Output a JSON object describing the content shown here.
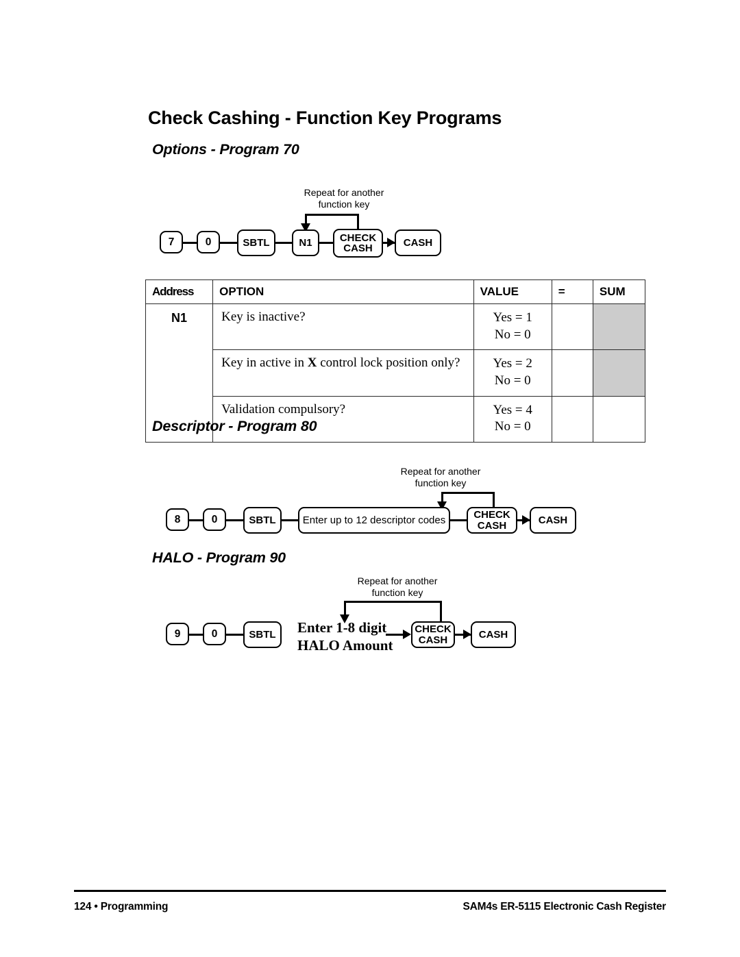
{
  "page": {
    "title": "Check Cashing - Function Key Programs"
  },
  "sections": {
    "options": {
      "heading": "Options - Program 70",
      "diagram": {
        "loop_label": "Repeat for another\nfunction key",
        "keys": [
          {
            "label": "7"
          },
          {
            "label": "0"
          },
          {
            "label": "SBTL"
          },
          {
            "label": "N1"
          },
          {
            "line1": "CHECK",
            "line2": "CASH"
          },
          {
            "label": "CASH"
          }
        ]
      },
      "table": {
        "headers": [
          "Address",
          "OPTION",
          "VALUE",
          "=",
          "SUM"
        ],
        "address": "N1",
        "rows": [
          {
            "option_pre": "Key is inactive?",
            "option_bold": "",
            "option_post": "",
            "value": "Yes = 1\nNo = 0",
            "sum_shaded": true
          },
          {
            "option_pre": "Key in active in ",
            "option_bold": "X",
            "option_post": " control lock position only?",
            "value": "Yes = 2\nNo = 0",
            "sum_shaded": true
          },
          {
            "option_pre": "Validation compulsory?",
            "option_bold": "",
            "option_post": "",
            "value": "Yes = 4\nNo = 0",
            "sum_shaded": false
          }
        ]
      }
    },
    "descriptor": {
      "heading": "Descriptor - Program 80",
      "diagram": {
        "loop_label": "Repeat for another\nfunction key",
        "keys": [
          {
            "label": "8"
          },
          {
            "label": "0"
          },
          {
            "label": "SBTL"
          },
          {
            "label": "Enter up to 12 descriptor codes"
          },
          {
            "line1": "CHECK",
            "line2": "CASH"
          },
          {
            "label": "CASH"
          }
        ]
      }
    },
    "halo": {
      "heading": "HALO - Program 90",
      "diagram": {
        "loop_label": "Repeat for another\nfunction key",
        "note": "Enter 1-8 digit\nHALO Amount",
        "keys": [
          {
            "label": "9"
          },
          {
            "label": "0"
          },
          {
            "label": "SBTL"
          },
          {
            "line1": "CHECK",
            "line2": "CASH"
          },
          {
            "label": "CASH"
          }
        ]
      }
    }
  },
  "footer": {
    "left": "124 • Programming",
    "right": "SAM4s ER-5115 Electronic Cash Register"
  },
  "colors": {
    "ink": "#000000",
    "shade": "#cccccc",
    "paper": "#ffffff"
  }
}
